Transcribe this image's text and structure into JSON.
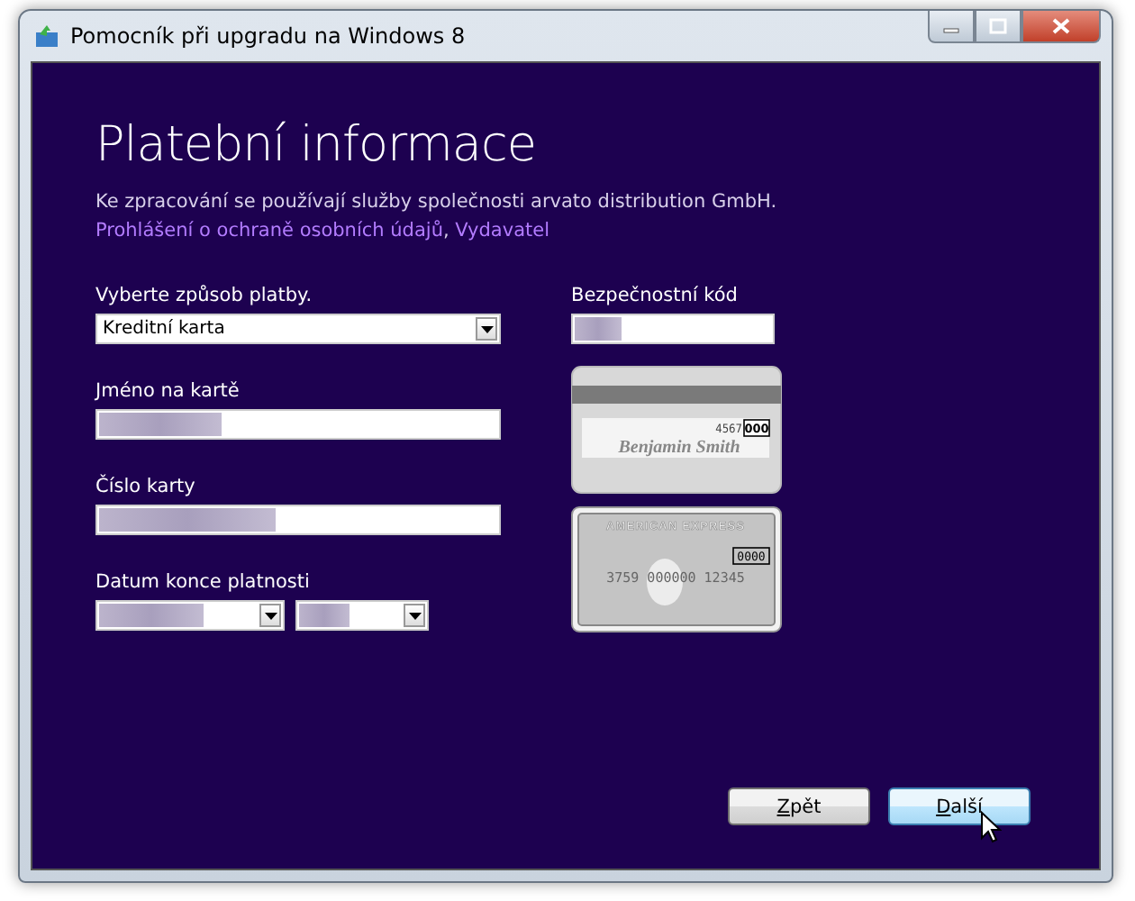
{
  "window": {
    "title": "Pomocník při upgradu na Windows 8"
  },
  "heading": "Platební informace",
  "notice": {
    "text": "Ke zpracování se používají služby společnosti arvato distribution GmbH.",
    "links": [
      "Prohlášení o ochraně osobních údajů",
      "Vydavatel"
    ],
    "link_separator": ","
  },
  "payment_method": {
    "label": "Vyberte způsob platby.",
    "value": "Kreditní karta"
  },
  "card_name": {
    "label": "Jméno na kartě",
    "value_redacted": true
  },
  "card_number": {
    "label": "Číslo karty",
    "value_redacted": true
  },
  "expiry": {
    "label": "Datum konce platnosti",
    "value_redacted": true
  },
  "security_code": {
    "label": "Bezpečnostní kód",
    "value_redacted": true
  },
  "card_back": {
    "number": "4567",
    "code": "000",
    "name": "Benjamin Smith"
  },
  "card_front": {
    "brand": "AMERICAN EXPRESS",
    "code": "0000",
    "number": "3759 000000 12345"
  },
  "buttons": [
    {
      "label": "Zpět",
      "hovered": false
    },
    {
      "label": "Další",
      "hovered": true
    }
  ]
}
